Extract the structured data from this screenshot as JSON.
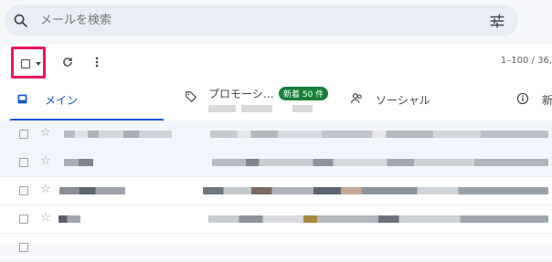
{
  "search": {
    "placeholder": "メールを検索",
    "search_icon": "search-icon",
    "filter_icon": "tune-icon"
  },
  "toolbar": {
    "select_icon": "checkbox-icon",
    "dropdown_icon": "caret-down-icon",
    "refresh_icon": "refresh-icon",
    "more_icon": "more-vert-icon",
    "pager": "1–100 / 36,"
  },
  "tabs": [
    {
      "label": "メイン",
      "icon": "inbox-icon",
      "active": true
    },
    {
      "label": "プロモーシ…",
      "icon": "tag-icon",
      "badge": "新着 50 件"
    },
    {
      "label": "ソーシャル",
      "icon": "people-icon"
    },
    {
      "label": "新",
      "icon": "info-icon"
    }
  ],
  "rows": [
    {
      "read": true
    },
    {
      "read": true
    },
    {
      "read": false
    },
    {
      "read": false
    },
    {
      "read": false
    }
  ],
  "colors": {
    "highlight": "#e8175d",
    "accent": "#0b57d0",
    "badge": "#188038"
  }
}
